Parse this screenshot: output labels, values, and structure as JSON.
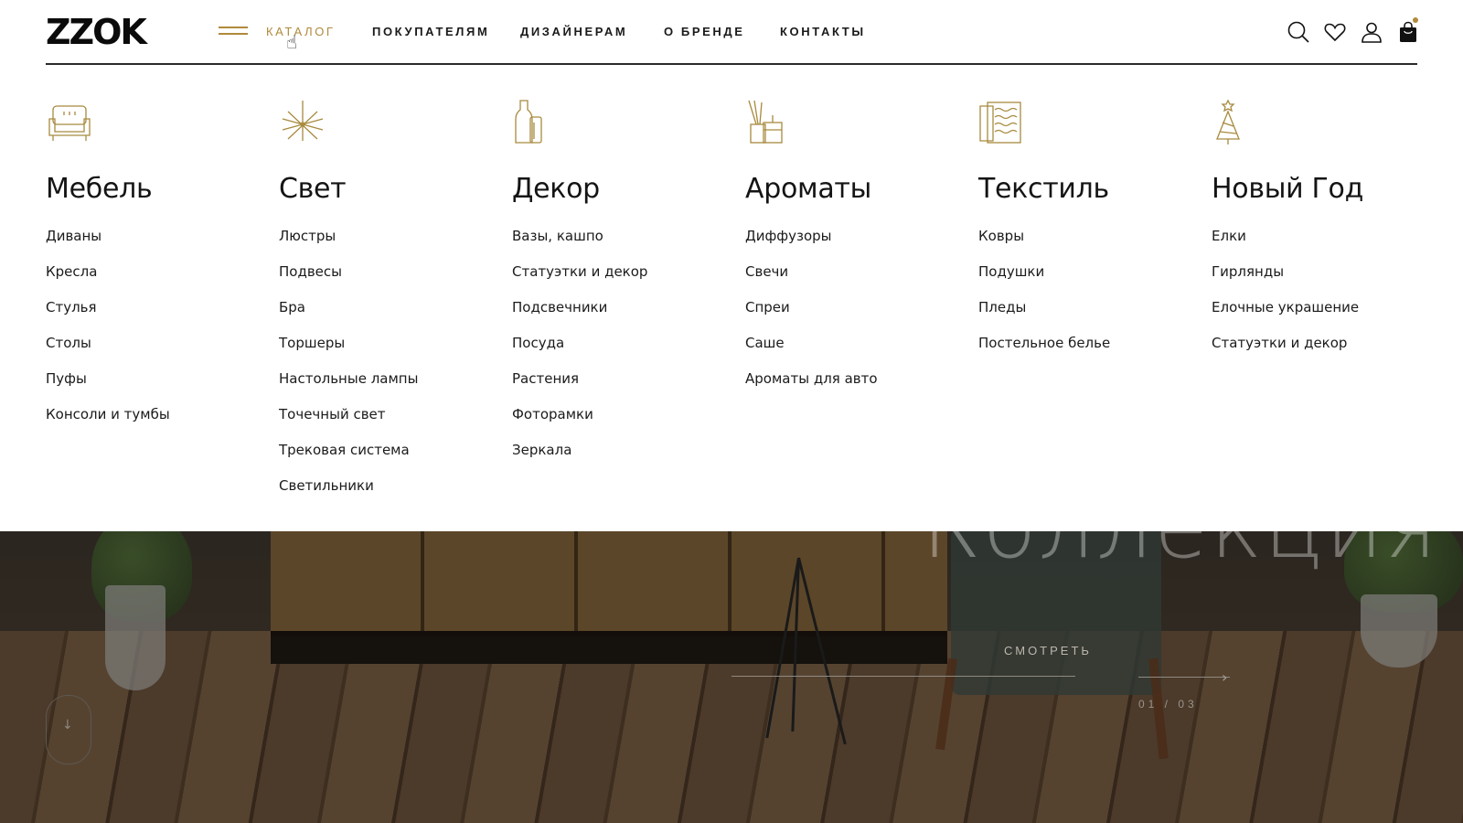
{
  "brand": {
    "logo": "ZZOK",
    "accent": "#b08a3c"
  },
  "nav": [
    {
      "label": "КАТАЛОГ",
      "active": true
    },
    {
      "label": "ПОКУПАТЕЛЯМ"
    },
    {
      "label": "ДИЗАЙНЕРАМ"
    },
    {
      "label": "О БРЕНДЕ"
    },
    {
      "label": "КОНТАКТЫ"
    }
  ],
  "header_icons": [
    "search-icon",
    "heart-icon",
    "user-icon",
    "cart-icon"
  ],
  "catalog": [
    {
      "icon": "sofa-icon",
      "title": "Мебель",
      "items": [
        "Диваны",
        "Кресла",
        "Стулья",
        "Столы",
        "Пуфы",
        "Консоли и тумбы"
      ]
    },
    {
      "icon": "chandelier-icon",
      "title": "Свет",
      "items": [
        "Люстры",
        "Подвесы",
        "Бра",
        "Торшеры",
        "Настольные лампы",
        "Точечный свет",
        "Трековая система",
        "Светильники"
      ]
    },
    {
      "icon": "vase-icon",
      "title": "Декор",
      "items": [
        "Вазы, кашпо",
        "Статуэтки и декор",
        "Подсвечники",
        "Посуда",
        "Растения",
        "Фоторамки",
        "Зеркала"
      ]
    },
    {
      "icon": "diffuser-icon",
      "title": "Ароматы",
      "items": [
        "Диффузоры",
        "Свечи",
        "Спреи",
        "Саше",
        "Ароматы для авто"
      ]
    },
    {
      "icon": "textile-icon",
      "title": "Текстиль",
      "items": [
        "Ковры",
        "Подушки",
        "Пледы",
        "Постельное белье"
      ]
    },
    {
      "icon": "christmas-tree-icon",
      "title": "Новый Год",
      "items": [
        "Елки",
        "Гирлянды",
        "Елочные украшение",
        "Статуэтки и декор"
      ]
    }
  ],
  "hero": {
    "title": "Коллекция",
    "cta": "СМОТРЕТЬ",
    "slide_counter": "01 / 03"
  }
}
